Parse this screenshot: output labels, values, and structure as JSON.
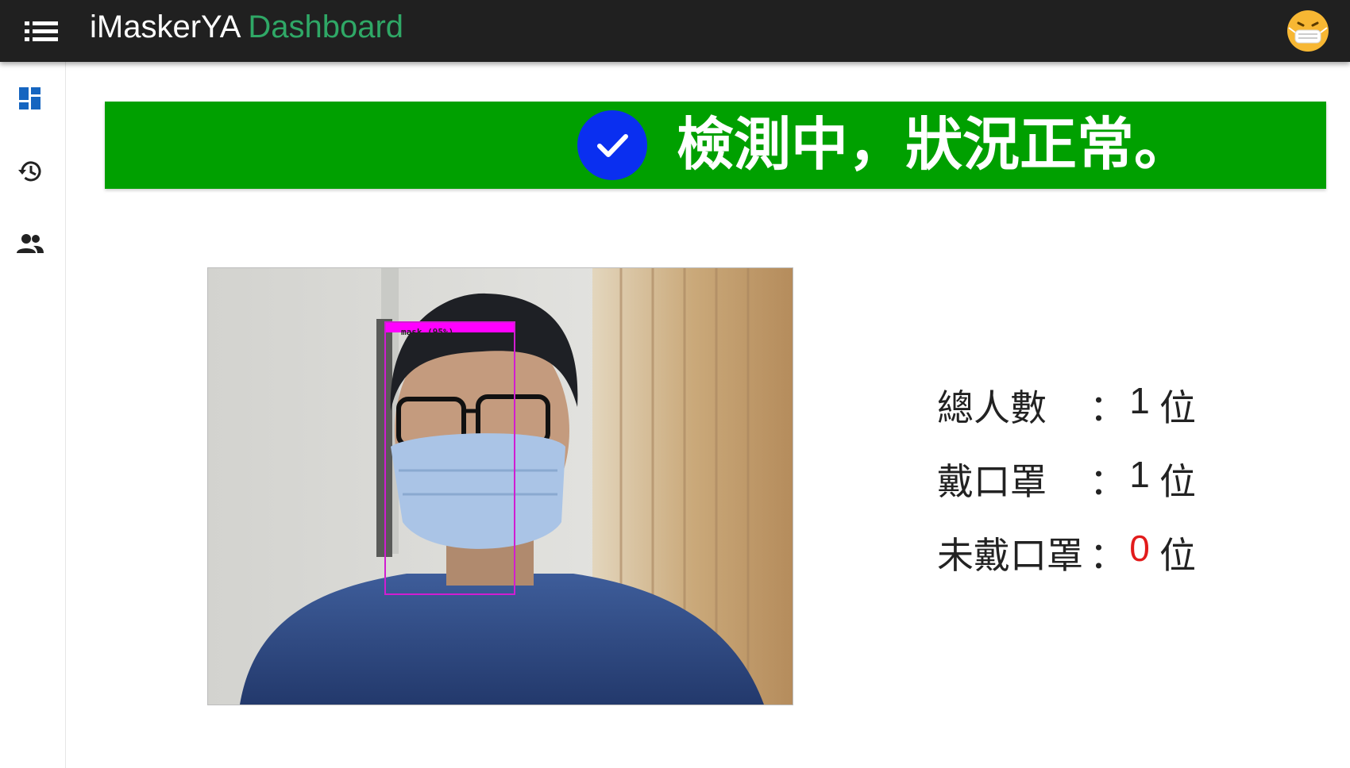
{
  "header": {
    "brand": "iMaskerYA",
    "title_accent": "Dashboard",
    "menu_icon": "menu-icon",
    "avatar_icon": "masked-face-emoji"
  },
  "sidebar": {
    "items": [
      {
        "icon": "dashboard-icon",
        "color": "#1565c0"
      },
      {
        "icon": "history-icon",
        "color": "#222222"
      },
      {
        "icon": "people-icon",
        "color": "#222222"
      }
    ]
  },
  "status_banner": {
    "text": "檢測中，狀況正常。",
    "icon": "check-circle-icon",
    "background": "#00a000",
    "icon_color": "#0a2ff0"
  },
  "camera": {
    "detection_label": "mask (95%)",
    "box_color": "#ff00ff"
  },
  "stats": {
    "rows": [
      {
        "label": "總人數",
        "colon": "：",
        "value": "1",
        "unit": "位"
      },
      {
        "label": "戴口罩",
        "colon": "：",
        "value": "1",
        "unit": "位"
      },
      {
        "label": "未戴口罩",
        "colon": "：",
        "value": "0",
        "unit": "位"
      }
    ],
    "alert_color": "#e21b1b"
  }
}
